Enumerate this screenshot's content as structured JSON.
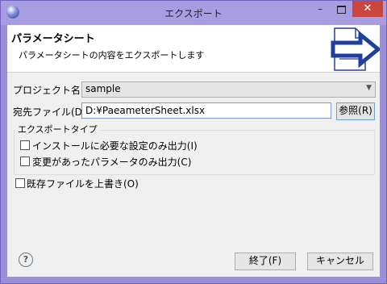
{
  "window": {
    "title": "エクスポート"
  },
  "header": {
    "title": "パラメータシート",
    "description": "パラメータシートの内容をエクスポートします",
    "graphic_icon": "export-sheet-icon"
  },
  "form": {
    "project_label": "プロジェクト名(P):",
    "project_value": "sample",
    "dest_label": "宛先ファイル(D):",
    "dest_value": "D:¥PaeameterSheet.xlsx",
    "browse_label": "参照(R)",
    "group_title": "エクスポートタイプ",
    "option1_label": "インストールに必要な設定のみ出力(I)",
    "option2_label": "変更があったパラメータのみ出力(C)",
    "overwrite_label": "既存ファイルを上書き(O)"
  },
  "checkbox_states": {
    "option1": false,
    "option2": false,
    "overwrite": false
  },
  "footer": {
    "help_glyph": "?",
    "finish_label": "終了(F)",
    "cancel_label": "キャンセル"
  },
  "colors": {
    "title_bar": "#a89de0",
    "close_button": "#c9453d",
    "arrow": "#1f3f9b"
  }
}
